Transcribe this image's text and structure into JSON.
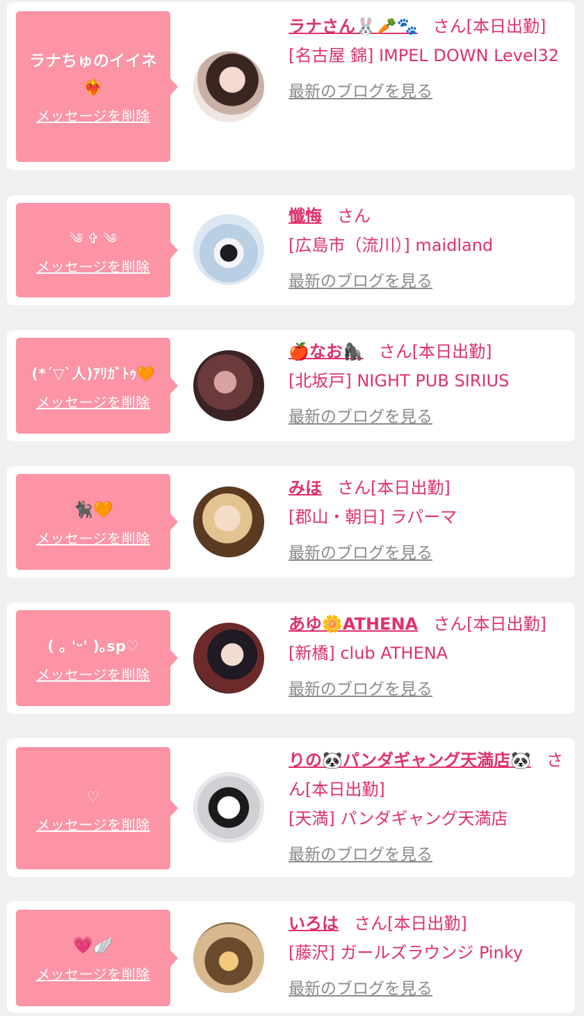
{
  "delete_label": "メッセージを削除",
  "blog_label": "最新のブログを見る",
  "items": [
    {
      "message": "ラナちゅのイイネ❤️‍🔥",
      "name": "ラナさん🐰🥕🐾",
      "suffix": "さん[本日出勤]",
      "shop": "[名古屋 錦] IMPEL DOWN Level32"
    },
    {
      "message": "༄ ✞ ༄",
      "name": "懺悔",
      "suffix": "さん",
      "shop": "[広島市（流川）] maidland"
    },
    {
      "message": "(*´▽`人)ｱﾘｶﾞﾄｩ🧡",
      "name": "🍎なお🦍",
      "suffix": "さん[本日出勤]",
      "shop": "[北坂戸] NIGHT PUB SIRIUS"
    },
    {
      "message": "🐈‍⬛🧡",
      "name": "みほ",
      "suffix": "さん[本日出勤]",
      "shop": "[郡山・朝日] ラパーマ"
    },
    {
      "message": "( ｡ 'ᵕ' )｡sp♡",
      "name": "あゆ🌼ATHENA",
      "suffix": "さん[本日出勤]",
      "shop": "[新橋] club ATHENA"
    },
    {
      "message": "♡",
      "name": "りの🐼パンダギャング天満店🐼",
      "suffix": "さん[本日出勤]",
      "shop": "[天満] パンダギャング天満店"
    },
    {
      "message": "💗🪽",
      "name": "いろは",
      "suffix": "さん[本日出勤]",
      "shop": "[藤沢] ガールズラウンジ Pinky"
    }
  ],
  "colors": {
    "bubble": "#fd94a6",
    "accent": "#e0306b",
    "muted": "#8a8a8a",
    "background": "#f1f0f0"
  }
}
